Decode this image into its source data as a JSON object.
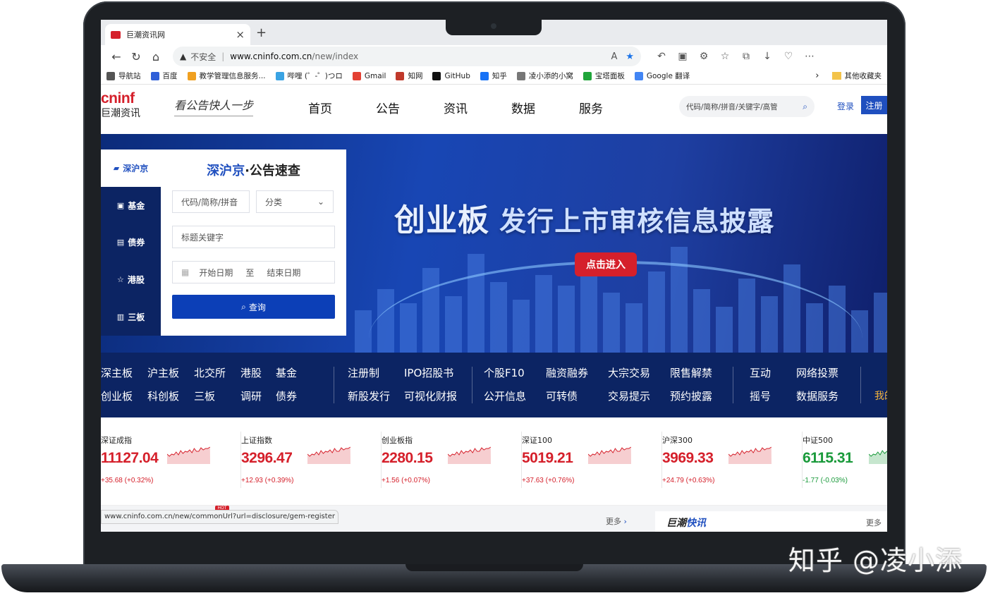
{
  "browser": {
    "tab_title": "巨潮资讯网",
    "tab_close": "×",
    "new_tab": "+",
    "security_label": "不安全",
    "url_host": "www.cninfo.com.cn",
    "url_path": "/new/index",
    "status_url": "www.cninfo.com.cn/new/commonUrl?url=disclosure/gem-register",
    "nav": {
      "back": "←",
      "reload": "↻",
      "home": "⌂"
    },
    "bookmarks": [
      {
        "label": "导航站",
        "color": "#555555"
      },
      {
        "label": "百度",
        "color": "#2f5fd8"
      },
      {
        "label": "教学管理信息服务...",
        "color": "#f0a020"
      },
      {
        "label": "哔哩 (゜-゜)つロ",
        "color": "#3aa3e3"
      },
      {
        "label": "Gmail",
        "color": "#e34133"
      },
      {
        "label": "知网",
        "color": "#c0392b"
      },
      {
        "label": "GitHub",
        "color": "#111111"
      },
      {
        "label": "知乎",
        "color": "#1772f6"
      },
      {
        "label": "凌小添的小窝",
        "color": "#777777"
      },
      {
        "label": "宝塔面板",
        "color": "#20a53a"
      },
      {
        "label": "Google 翻译",
        "color": "#4285f4"
      }
    ],
    "other_bookmarks": "其他收藏夹"
  },
  "site": {
    "logo_brand": "cninf",
    "logo_cn": "巨潮资讯",
    "slogan": "看公告快人一步",
    "nav": [
      "首页",
      "公告",
      "资讯",
      "数据",
      "服务"
    ],
    "search_placeholder": "代码/简称/拼音/关键字/高管",
    "login": "登录",
    "register": "注册"
  },
  "hero": {
    "headline_main": "创业板",
    "headline_sub": " 发行上市审核信息披露",
    "enter_button": "点击进入"
  },
  "quick_query": {
    "tabs": [
      {
        "label": "深沪京",
        "icon": "▰"
      },
      {
        "label": "基金",
        "icon": "▣"
      },
      {
        "label": "债券",
        "icon": "▤"
      },
      {
        "label": "港股",
        "icon": "☆"
      },
      {
        "label": "三板",
        "icon": "▥"
      }
    ],
    "title_blue": "深沪京",
    "title_rest": "·公告速查",
    "code_placeholder": "代码/简称/拼音",
    "category": "分类",
    "keyword_placeholder": "标题关键字",
    "start_date": "开始日期",
    "to": "至",
    "end_date": "结束日期",
    "search_button": "查询"
  },
  "links": {
    "groups": [
      [
        [
          "深主板",
          "沪主板",
          "北交所",
          "港股",
          "基金"
        ],
        [
          "创业板",
          "科创板",
          "三板",
          "调研",
          "债券"
        ]
      ],
      [
        [
          "注册制",
          "IPO招股书"
        ],
        [
          "新股发行",
          "可视化财报"
        ]
      ],
      [
        [
          "个股F10",
          "融资融券",
          "大宗交易",
          "限售解禁"
        ],
        [
          "公开信息",
          "可转债",
          "交易提示",
          "预约披露"
        ]
      ],
      [
        [
          "互动",
          "网络投票"
        ],
        [
          "摇号",
          "数据服务"
        ]
      ]
    ],
    "mine": "我的"
  },
  "indices": [
    {
      "name": "深证成指",
      "value": "11127.04",
      "change": "+35.68 (+0.32%)",
      "trend": "up"
    },
    {
      "name": "上证指数",
      "value": "3296.47",
      "change": "+12.93 (+0.39%)",
      "trend": "up"
    },
    {
      "name": "创业板指",
      "value": "2280.15",
      "change": "+1.56 (+0.07%)",
      "trend": "up"
    },
    {
      "name": "深证100",
      "value": "5019.21",
      "change": "+37.63 (+0.76%)",
      "trend": "up"
    },
    {
      "name": "沪深300",
      "value": "3969.33",
      "change": "+24.79 (+0.63%)",
      "trend": "up"
    },
    {
      "name": "中证500",
      "value": "6115.31",
      "change": "-1.77 (-0.03%)",
      "trend": "down"
    }
  ],
  "bottom": {
    "hot": "HOT",
    "more": "更多",
    "news_title_a": "巨潮",
    "news_title_b": "快讯"
  },
  "watermark": "知乎 @凌小添",
  "colors": {
    "brand_red": "#d5202b",
    "brand_blue": "#1f4fbf",
    "navy": "#0c2463",
    "down_green": "#1a9a3b"
  }
}
